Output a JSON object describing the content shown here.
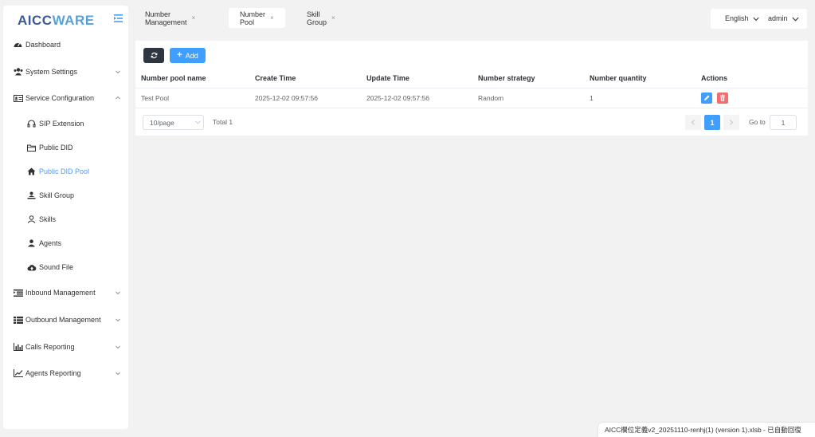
{
  "app": {
    "logo_main": "AICC",
    "logo_accent": "WARE"
  },
  "sidebar": {
    "dashboard": {
      "label": "Dashboard",
      "icon": "dashboard-icon"
    },
    "system_settings": {
      "label": "System Settings",
      "icon": "users-icon"
    },
    "service_configuration": {
      "label": "Service Configuration",
      "icon": "id-card-icon"
    },
    "sub_items": [
      {
        "label": "SIP Extension",
        "icon": "headset-icon"
      },
      {
        "label": "Public DID",
        "icon": "folder-icon"
      },
      {
        "label": "Public DID Pool",
        "icon": "home-icon"
      },
      {
        "label": "Skill Group",
        "icon": "user-group-icon"
      },
      {
        "label": "Skills",
        "icon": "user-outline-icon"
      },
      {
        "label": "Agents",
        "icon": "user-icon"
      },
      {
        "label": "Sound File",
        "icon": "cloud-upload-icon"
      }
    ],
    "inbound_management": {
      "label": "Inbound Management",
      "icon": "indent-icon"
    },
    "outbound_management": {
      "label": "Outbound Management",
      "icon": "list-icon"
    },
    "calls_reporting": {
      "label": "Calls Reporting",
      "icon": "bar-chart-icon"
    },
    "agents_reporting": {
      "label": "Agents Reporting",
      "icon": "line-chart-icon"
    }
  },
  "tabs": [
    {
      "label": "Number Management",
      "close": "×"
    },
    {
      "label": "Number Pool",
      "close": "×"
    },
    {
      "label": "Skill Group",
      "close": "×"
    }
  ],
  "header": {
    "language": "English",
    "user": "admin"
  },
  "toolbar": {
    "add_label": "Add"
  },
  "table": {
    "columns": [
      "Number pool name",
      "Create Time",
      "Update Time",
      "Number strategy",
      "Number quantity",
      "Actions"
    ],
    "rows": [
      {
        "name": "Test Pool",
        "create_time": "2025-12-02 09:57:56",
        "update_time": "2025-12-02 09:57:56",
        "strategy": "Random",
        "quantity": "1"
      }
    ]
  },
  "pagination": {
    "page_size": "10/page",
    "total": "Total 1",
    "current_page": "1",
    "goto_label": "Go to",
    "goto_value": "1"
  },
  "notification": {
    "text": "AICC欄位定義v2_20251110-renhj(1) (version 1).xlsb  -  已自動回復"
  },
  "colors": {
    "primary": "#409eff",
    "danger": "#f56c6c",
    "dark_button": "#2f3541",
    "logo_blue": "#3c5a9a",
    "logo_light": "#57a3d8"
  }
}
